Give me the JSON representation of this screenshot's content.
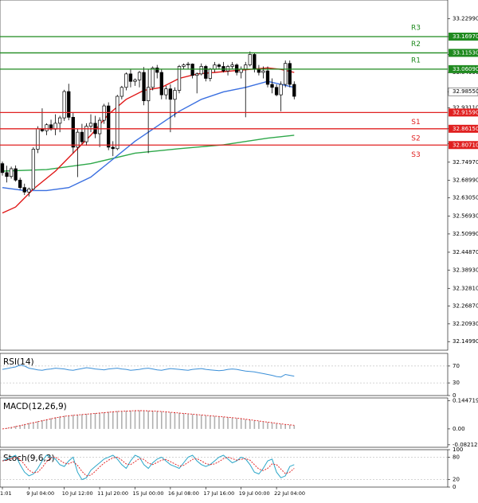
{
  "chart_data": {
    "type": "candlestick",
    "main": {
      "ylim": [
        32.1212,
        33.2921
      ],
      "y_ticks": [
        "33.22990",
        "33.16970",
        "33.10950",
        "33.04990",
        "32.98550",
        "32.93110",
        "32.86150",
        "32.81110",
        "32.74970",
        "32.68990",
        "32.63050",
        "32.56930",
        "32.50990",
        "32.44870",
        "32.38930",
        "32.32810",
        "32.26870",
        "32.20930",
        "32.14990"
      ],
      "last_price": "32.98550",
      "levels": [
        {
          "label": "R3",
          "value": 33.1697,
          "value_text": "33.16970",
          "color": "#1f8a1f"
        },
        {
          "label": "R2",
          "value": 33.1153,
          "value_text": "33.11530",
          "color": "#1f8a1f"
        },
        {
          "label": "R1",
          "value": 33.0609,
          "value_text": "33.06090",
          "color": "#1f8a1f"
        },
        {
          "label": "S1",
          "value": 32.9159,
          "value_text": "32.91590",
          "color": "#e02020"
        },
        {
          "label": "S2",
          "value": 32.8615,
          "value_text": "32.86150",
          "color": "#e02020"
        },
        {
          "label": "S3",
          "value": 32.8071,
          "value_text": "32.80710",
          "color": "#e02020"
        }
      ],
      "candles": [
        [
          32.745,
          32.752,
          32.705,
          32.715
        ],
        [
          32.715,
          32.738,
          32.682,
          32.702
        ],
        [
          32.702,
          32.735,
          32.695,
          32.728
        ],
        [
          32.728,
          32.739,
          32.685,
          32.69
        ],
        [
          32.69,
          32.698,
          32.658,
          32.665
        ],
        [
          32.665,
          32.678,
          32.64,
          32.65
        ],
        [
          32.65,
          32.665,
          32.635,
          32.66
        ],
        [
          32.66,
          32.8,
          32.658,
          32.793
        ],
        [
          32.793,
          32.87,
          32.78,
          32.862
        ],
        [
          32.862,
          32.93,
          32.85,
          32.855
        ],
        [
          32.855,
          32.88,
          32.84,
          32.875
        ],
        [
          32.875,
          32.892,
          32.855,
          32.86
        ],
        [
          32.86,
          32.91,
          32.84,
          32.88
        ],
        [
          32.88,
          32.905,
          32.85,
          32.898
        ],
        [
          32.898,
          32.992,
          32.888,
          32.986
        ],
        [
          32.986,
          33.012,
          32.89,
          32.9
        ],
        [
          32.9,
          32.915,
          32.78,
          32.8
        ],
        [
          32.8,
          32.86,
          32.7,
          32.85
        ],
        [
          32.85,
          32.878,
          32.81,
          32.818
        ],
        [
          32.818,
          32.88,
          32.805,
          32.87
        ],
        [
          32.87,
          32.91,
          32.85,
          32.88
        ],
        [
          32.88,
          32.905,
          32.83,
          32.845
        ],
        [
          32.845,
          32.9,
          32.8,
          32.89
        ],
        [
          32.89,
          32.945,
          32.878,
          32.938
        ],
        [
          32.938,
          32.95,
          32.79,
          32.8
        ],
        [
          32.8,
          32.82,
          32.77,
          32.795
        ],
        [
          32.795,
          32.975,
          32.79,
          32.97
        ],
        [
          32.97,
          33.005,
          32.96,
          33.0
        ],
        [
          33.0,
          33.05,
          32.99,
          33.045
        ],
        [
          33.045,
          33.06,
          33.0,
          33.02
        ],
        [
          33.02,
          33.03,
          33.005,
          33.025
        ],
        [
          33.025,
          33.055,
          33.0,
          33.05
        ],
        [
          33.05,
          33.068,
          32.94,
          32.955
        ],
        [
          32.955,
          33.06,
          32.78,
          33.0
        ],
        [
          33.0,
          33.07,
          32.99,
          33.065
        ],
        [
          33.065,
          33.075,
          33.03,
          33.05
        ],
        [
          33.05,
          33.06,
          32.96,
          32.975
        ],
        [
          32.975,
          33.005,
          32.96,
          32.995
        ],
        [
          32.995,
          33.01,
          32.85,
          32.96
        ],
        [
          32.96,
          33.0,
          32.9,
          32.99
        ],
        [
          32.99,
          33.075,
          32.98,
          33.07
        ],
        [
          33.07,
          33.08,
          33.06,
          33.075
        ],
        [
          33.075,
          33.085,
          33.06,
          33.078
        ],
        [
          33.078,
          33.08,
          33.03,
          33.04
        ],
        [
          33.04,
          33.05,
          32.98,
          33.045
        ],
        [
          33.045,
          33.08,
          33.04,
          33.07
        ],
        [
          33.07,
          33.075,
          33.02,
          33.03
        ],
        [
          33.03,
          33.065,
          33.02,
          33.06
        ],
        [
          33.06,
          33.085,
          33.05,
          33.075
        ],
        [
          33.075,
          33.08,
          33.06,
          33.07
        ],
        [
          33.07,
          33.085,
          33.05,
          33.055
        ],
        [
          33.055,
          33.075,
          33.04,
          33.07
        ],
        [
          33.07,
          33.085,
          33.06,
          33.075
        ],
        [
          33.075,
          33.08,
          33.04,
          33.05
        ],
        [
          33.05,
          33.07,
          33.03,
          33.06
        ],
        [
          33.06,
          33.085,
          32.9,
          33.075
        ],
        [
          33.075,
          33.12,
          33.07,
          33.11
        ],
        [
          33.11,
          33.115,
          33.05,
          33.06
        ],
        [
          33.06,
          33.075,
          33.04,
          33.05
        ],
        [
          33.05,
          33.07,
          33.03,
          33.055
        ],
        [
          33.055,
          33.07,
          33.0,
          33.01
        ],
        [
          33.01,
          33.03,
          32.98,
          33.0
        ],
        [
          33.0,
          33.01,
          32.97,
          32.975
        ],
        [
          32.975,
          33.02,
          32.92,
          33.01
        ],
        [
          33.01,
          33.09,
          33.0,
          33.08
        ],
        [
          33.08,
          33.09,
          33.0,
          33.01
        ],
        [
          33.01,
          33.02,
          32.96,
          32.97
        ]
      ],
      "ma_slow_green": [
        [
          0,
          32.72
        ],
        [
          10,
          32.725
        ],
        [
          20,
          32.745
        ],
        [
          30,
          32.78
        ],
        [
          40,
          32.795
        ],
        [
          50,
          32.808
        ],
        [
          60,
          32.83
        ],
        [
          66,
          32.84
        ]
      ],
      "ma_mid_blue": [
        [
          0,
          32.665
        ],
        [
          5,
          32.655
        ],
        [
          10,
          32.655
        ],
        [
          15,
          32.665
        ],
        [
          20,
          32.7
        ],
        [
          25,
          32.76
        ],
        [
          30,
          32.82
        ],
        [
          35,
          32.87
        ],
        [
          40,
          32.92
        ],
        [
          45,
          32.96
        ],
        [
          50,
          32.985
        ],
        [
          55,
          33.0
        ],
        [
          60,
          33.02
        ],
        [
          66,
          33.0
        ]
      ],
      "ma_fast_red": [
        [
          0,
          32.58
        ],
        [
          3,
          32.6
        ],
        [
          7,
          32.66
        ],
        [
          12,
          32.72
        ],
        [
          16,
          32.78
        ],
        [
          20,
          32.84
        ],
        [
          24,
          32.91
        ],
        [
          28,
          32.96
        ],
        [
          32,
          32.99
        ],
        [
          36,
          33.0
        ],
        [
          40,
          33.03
        ],
        [
          44,
          33.045
        ],
        [
          48,
          33.05
        ],
        [
          52,
          33.055
        ],
        [
          56,
          33.06
        ],
        [
          60,
          33.065
        ],
        [
          63,
          33.06
        ],
        [
          66,
          33.05
        ]
      ]
    },
    "rsi": {
      "label": "RSI(14)",
      "ticks": [
        "70",
        "30",
        "0"
      ],
      "ylim": [
        0,
        100
      ],
      "tick_values": [
        70,
        30,
        0
      ],
      "values": [
        62,
        64,
        66,
        68,
        72,
        70,
        65,
        63,
        61,
        60,
        62,
        63,
        65,
        64,
        63,
        61,
        60,
        62,
        64,
        66,
        65,
        63,
        62,
        61,
        63,
        64,
        65,
        63,
        62,
        60,
        61,
        62,
        64,
        65,
        63,
        61,
        60,
        62,
        64,
        63,
        62,
        61,
        60,
        62,
        63,
        64,
        62,
        61,
        60,
        59,
        60,
        62,
        63,
        62,
        60,
        58,
        57,
        56,
        54,
        52,
        50,
        48,
        45,
        44,
        50,
        48,
        46
      ]
    },
    "macd": {
      "label": "MACD(12,26,9)",
      "ticks": [
        "0.144719",
        "0.00",
        "-0.08212"
      ],
      "ylim": [
        -0.095,
        0.16
      ],
      "tick_values": [
        0.144719,
        0,
        -0.08212
      ],
      "histogram": [
        0.0,
        0.005,
        0.01,
        0.015,
        0.02,
        0.025,
        0.03,
        0.035,
        0.04,
        0.045,
        0.05,
        0.055,
        0.06,
        0.065,
        0.068,
        0.07,
        0.072,
        0.074,
        0.076,
        0.078,
        0.08,
        0.082,
        0.084,
        0.086,
        0.088,
        0.09,
        0.092,
        0.093,
        0.094,
        0.095,
        0.096,
        0.096,
        0.095,
        0.094,
        0.093,
        0.092,
        0.09,
        0.088,
        0.086,
        0.084,
        0.082,
        0.08,
        0.078,
        0.076,
        0.074,
        0.072,
        0.07,
        0.068,
        0.066,
        0.064,
        0.062,
        0.06,
        0.058,
        0.055,
        0.052,
        0.049,
        0.046,
        0.043,
        0.04,
        0.037,
        0.034,
        0.031,
        0.028,
        0.025,
        0.022,
        0.02,
        0.018
      ],
      "signal": [
        0.0,
        0.003,
        0.007,
        0.012,
        0.017,
        0.022,
        0.027,
        0.032,
        0.037,
        0.042,
        0.047,
        0.052,
        0.057,
        0.061,
        0.065,
        0.068,
        0.07,
        0.072,
        0.074,
        0.076,
        0.078,
        0.08,
        0.082,
        0.084,
        0.086,
        0.088,
        0.09,
        0.091,
        0.092,
        0.093,
        0.094,
        0.094,
        0.094,
        0.093,
        0.092,
        0.091,
        0.09,
        0.088,
        0.086,
        0.084,
        0.082,
        0.08,
        0.078,
        0.076,
        0.074,
        0.072,
        0.07,
        0.068,
        0.066,
        0.064,
        0.062,
        0.06,
        0.058,
        0.056,
        0.053,
        0.05,
        0.047,
        0.044,
        0.041,
        0.038,
        0.035,
        0.032,
        0.029,
        0.026,
        0.023,
        0.021,
        0.019
      ]
    },
    "stoch": {
      "label": "Stoch(9,6,3)",
      "ticks": [
        "100",
        "80",
        "20",
        "0"
      ],
      "ylim": [
        0,
        100
      ],
      "tick_values": [
        100,
        80,
        20,
        0
      ],
      "main": [
        70,
        75,
        80,
        85,
        60,
        40,
        30,
        35,
        50,
        70,
        85,
        80,
        75,
        60,
        55,
        70,
        80,
        40,
        20,
        25,
        45,
        55,
        65,
        75,
        80,
        85,
        75,
        60,
        50,
        70,
        85,
        80,
        60,
        50,
        65,
        75,
        80,
        70,
        60,
        55,
        50,
        65,
        80,
        85,
        70,
        60,
        55,
        60,
        70,
        80,
        85,
        75,
        65,
        70,
        80,
        75,
        60,
        40,
        35,
        50,
        70,
        75,
        40,
        25,
        30,
        55,
        60
      ],
      "signal": [
        70,
        72,
        76,
        80,
        74,
        60,
        45,
        38,
        40,
        52,
        68,
        78,
        80,
        72,
        64,
        62,
        68,
        58,
        42,
        30,
        32,
        42,
        54,
        64,
        72,
        78,
        80,
        72,
        62,
        60,
        68,
        76,
        74,
        64,
        60,
        66,
        72,
        74,
        68,
        62,
        56,
        58,
        66,
        74,
        76,
        70,
        63,
        60,
        62,
        68,
        76,
        80,
        76,
        72,
        74,
        76,
        72,
        60,
        48,
        44,
        50,
        62,
        60,
        48,
        36,
        40,
        50
      ]
    },
    "x_ticks": [
      {
        "label": "1:01",
        "index": 0
      },
      {
        "label": "9 Jul 04:00",
        "index": 6
      },
      {
        "label": "10 Jul 12:00",
        "index": 14
      },
      {
        "label": "11 Jul 20:00",
        "index": 22
      },
      {
        "label": "15 Jul 00:00",
        "index": 30
      },
      {
        "label": "16 Jul 08:00",
        "index": 38
      },
      {
        "label": "17 Jul 16:00",
        "index": 46
      },
      {
        "label": "19 Jul 00:00",
        "index": 54
      },
      {
        "label": "22 Jul 04:00",
        "index": 62
      }
    ]
  }
}
